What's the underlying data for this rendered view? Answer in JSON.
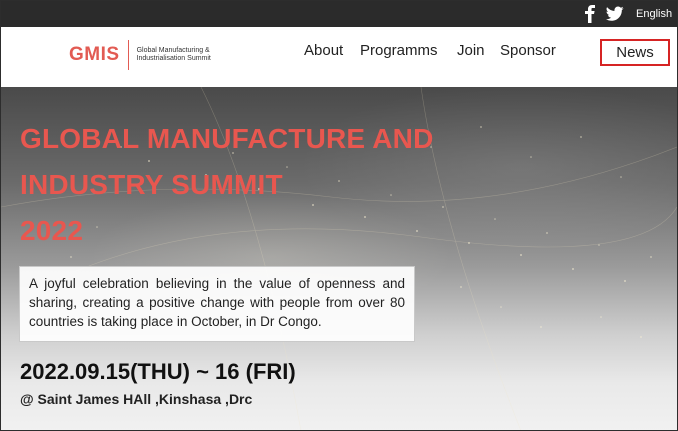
{
  "topbar": {
    "facebook_icon": "facebook-icon",
    "twitter_icon": "twitter-icon",
    "language_label": "English"
  },
  "header": {
    "logo_mark": "GMIS",
    "logo_subtitle": "Global Manufacturing & Industrialisation Summit",
    "nav": {
      "about": "About",
      "programms": "Programms",
      "join": "Join",
      "sponsor": "Sponsor",
      "news": "News"
    },
    "accent_color": "#e25b53",
    "highlight_border_color": "#d62424"
  },
  "hero": {
    "title_line_1": "GLOBAL MANUFACTURE AND",
    "title_line_2": "INDUSTRY SUMMIT",
    "title_line_3": "2022",
    "description": "A joyful celebration believing in the value of openness and sharing, creating a positive change with people from over 80 countries is taking place in October, in Dr Congo.",
    "date": "2022.09.15(THU) ~ 16 (FRI)",
    "venue": "@ Saint James HAll ,Kinshasa ,Drc",
    "title_color": "#e8574f"
  }
}
